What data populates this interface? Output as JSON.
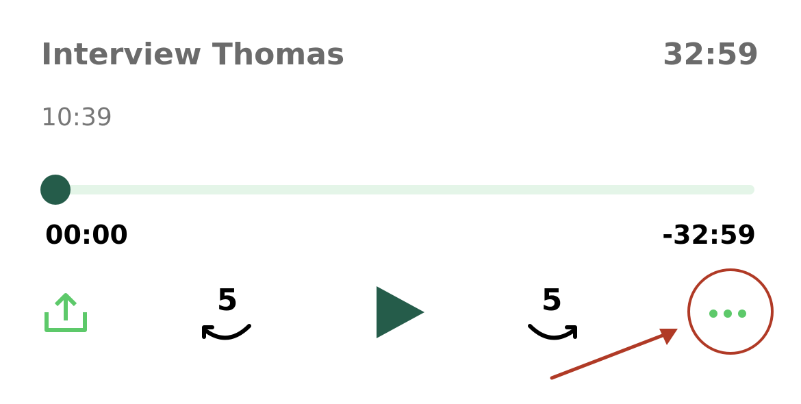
{
  "recording": {
    "title": "Interview Thomas",
    "duration": "32:59",
    "recorded_time": "10:39"
  },
  "player": {
    "progress_fraction": 0.0,
    "time_elapsed": "00:00",
    "time_remaining": "-32:59"
  },
  "controls": {
    "skip_back_seconds": "5",
    "skip_forward_seconds": "5",
    "icons": [
      "share-icon",
      "rewind-5-icon",
      "play-icon",
      "forward-5-icon",
      "more-icon"
    ]
  },
  "colors": {
    "accent_green": "#5dc96a",
    "play_dark_green": "#255c4a",
    "track_light_green": "#e4f5e8",
    "annotation_red": "#b03a26"
  }
}
